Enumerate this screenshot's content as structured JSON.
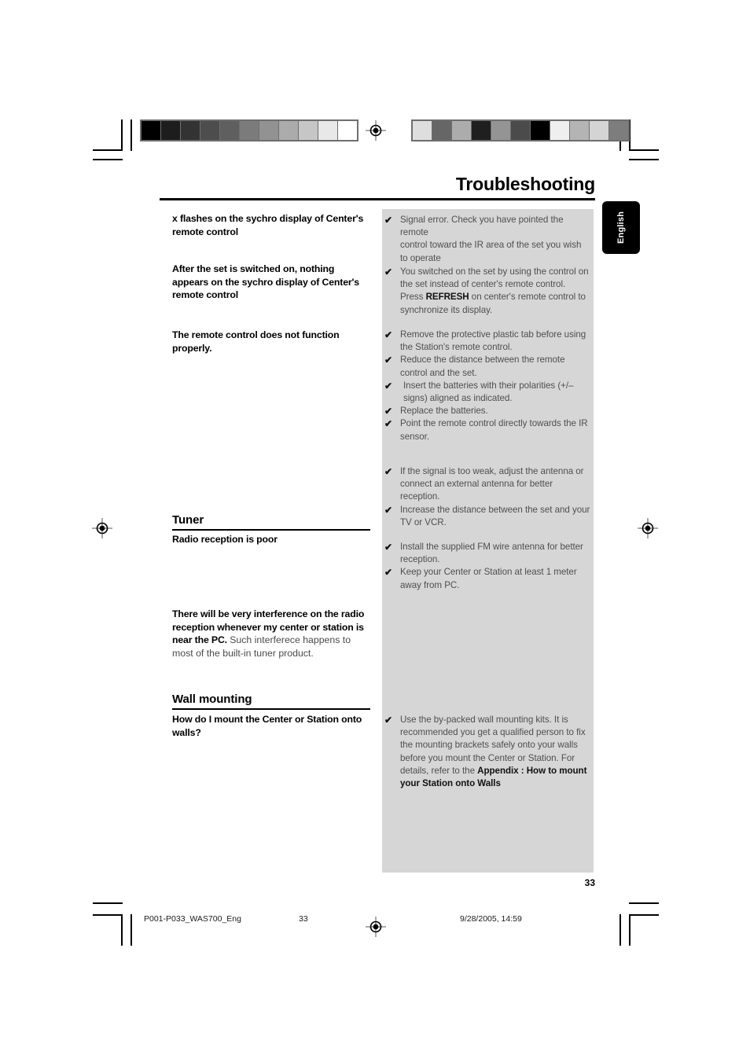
{
  "document": {
    "title": "Troubleshooting",
    "language_tab": "English",
    "page_number": "33"
  },
  "entries": [
    {
      "question": "x flashes on the sychro display of Center's remote control",
      "answers": [
        "Signal error. Check you have pointed the remote control toward the IR area of the set you wish to operate"
      ]
    },
    {
      "question": "After the set is switched on, nothing appears on the sychro display of Center's remote control",
      "answers": [
        "You switched on the set by using the control on the set instead of center's remote control. Press REFRESH on center's remote control to synchronize its display."
      ]
    },
    {
      "question": "The remote control does not function properly.",
      "answers": [
        "Remove the protective plastic tab before using the Station's remote control.",
        "Reduce the distance between the remote control and the set.",
        "Insert the batteries with their polarities (+/– signs) aligned as indicated.",
        "Replace the batteries.",
        "Point the remote control directly towards the IR sensor."
      ]
    }
  ],
  "sections": [
    {
      "heading": "Tuner",
      "question": "Radio reception is poor",
      "answers": [
        "If the signal is too weak, adjust the antenna or connect an external antenna for better reception.",
        "Increase the distance between the set and your TV or VCR.",
        "Install the supplied FM wire antenna for better reception.",
        "Keep your Center or Station at least 1 meter away from PC."
      ]
    },
    {
      "heading": "Wall mounting",
      "question": "How do I  mount the Center or Station onto walls?",
      "answers": [
        "Use the by-packed wall mounting kits.  It is recommended you get a qualified person to fix the mounting brackets safely onto your walls before you mount the Center or Station. For details, refer to the Appendix : How to mount your Station onto Walls"
      ]
    }
  ],
  "interference_note": {
    "question": "There will be very interference on the radio reception whenever my center or station is near the PC.",
    "note": "Such interferece happens to most of the built-in tuner product."
  },
  "answer_fragments": {
    "a1_line1": "Signal error. Check you have pointed the remote",
    "a1_line2": "control toward the IR area of the set you wish",
    "a1_line3": "to operate",
    "a2_part1": "You switched on the set by using the control on the set instead of center's remote control. Press ",
    "a2_bold": "REFRESH",
    "a2_part2": " on center's remote control to synchronize its display.",
    "a3_1": "Remove the protective plastic tab before using the Station's remote control.",
    "a3_2": "Reduce the distance between the remote control and the set.",
    "a3_3": "Insert the batteries with their polarities (+/– signs) aligned as indicated.",
    "a3_4": "Replace the batteries.",
    "a3_5": "Point the remote control directly towards the IR sensor.",
    "tuner_1": "If the signal is too weak, adjust the antenna or connect an external antenna for better reception.",
    "tuner_2": "Increase the distance between the set and your TV or VCR.",
    "tuner_3": "Install the supplied FM wire antenna for better reception.",
    "tuner_4": "Keep your Center or Station at least 1 meter away from PC.",
    "wall_part1": "Use the by-packed wall mounting kits.  It is recommended you get a qualified person to fix the mounting brackets safely onto your walls before you mount the Center or Station. For details, refer to the ",
    "wall_bold": "Appendix : How to mount your Station onto Walls"
  },
  "icons": {
    "tick": "✔"
  },
  "print_footer": {
    "filename": "P001-P033_WAS700_Eng",
    "page": "33",
    "timestamp": "9/28/2005, 14:59"
  },
  "calibration": {
    "left_bar_swatches": [
      "#000000",
      "#1d1d1d",
      "#333333",
      "#4d4d4d",
      "#5f5f5f",
      "#7b7b7b",
      "#929292",
      "#ababab",
      "#c6c6c6",
      "#e8e8e8",
      "#ffffff"
    ],
    "right_bar_swatches": [
      "#dedede",
      "#666666",
      "#acacac",
      "#1f1f1f",
      "#949494",
      "#4b4b4b",
      "#000000",
      "#efefef",
      "#b4b4b4",
      "#d4d4d4",
      "#7d7d7d"
    ]
  }
}
